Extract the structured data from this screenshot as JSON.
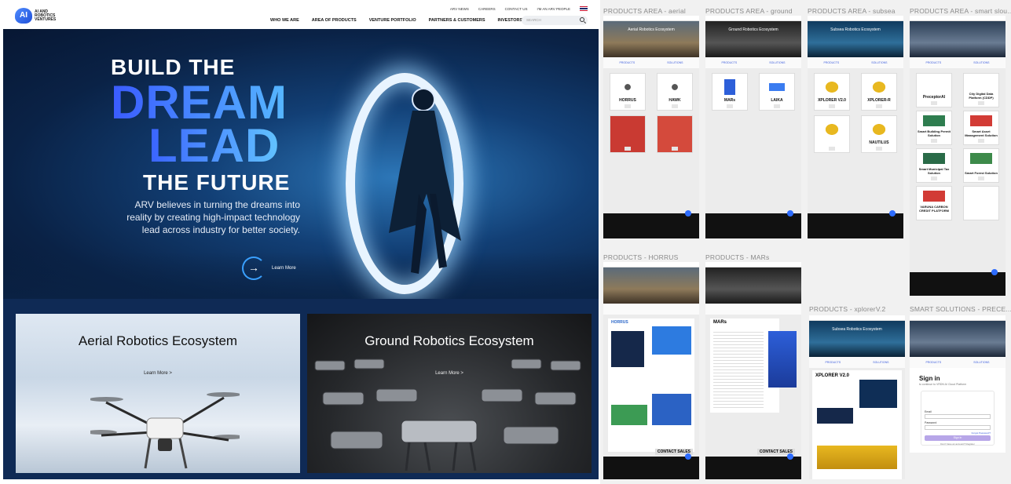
{
  "site": {
    "logo": {
      "mark": "AI",
      "text": "AI AND ROBOTICS VENTURES"
    },
    "utility_links": [
      "ARV NEWS",
      "CAREERS",
      "CONTACT US",
      "I'M AN ARV PEOPLE"
    ],
    "nav": [
      "WHO WE ARE",
      "AREA OF PRODUCTS",
      "VENTURE PORTFOLIO",
      "PARTNERS & CUSTOMERS",
      "INVESTORS"
    ],
    "search": {
      "placeholder": "SEARCH"
    },
    "hero": {
      "line1": "BUILD THE",
      "line2": "DREAM",
      "line3": "LEAD",
      "line4": "THE FUTURE",
      "body": "ARV believes in turning the dreams into reality by creating high-impact technology lead across industry for  better society.",
      "cta": "Learn More"
    },
    "ecosystems": [
      {
        "title": "Aerial Robotics Ecosystem",
        "more": "Learn More >"
      },
      {
        "title": "Ground Robotics Ecosystem",
        "more": "Learn More >"
      }
    ]
  },
  "board": {
    "labels": {
      "aerial": "PRODUCTS AREA - aerial",
      "ground": "PRODUCTS AREA - ground",
      "subsea": "PRODUCTS AREA - subsea",
      "smart": "PRODUCTS AREA - smart slou...",
      "horrus": "PRODUCTS - HORRUS",
      "mars": "PRODUCTS - MARs",
      "xplorer": "PRODUCTS - xplorerV.2",
      "precept": "SMART SOLUTIONS - PRECE..."
    },
    "aerial": {
      "banner": "Aerial Robotics Ecosystem",
      "tabs": [
        "PRODUCTS",
        "SOLUTIONS"
      ],
      "tiles": [
        "HORRUS",
        "HAWK",
        "",
        ""
      ]
    },
    "ground": {
      "banner": "Ground Robotics Ecosystem",
      "tabs": [
        "PRODUCTS",
        "SOLUTIONS"
      ],
      "tiles": [
        "MARs",
        "LAIKA"
      ]
    },
    "subsea": {
      "banner": "Subsea Robotics Ecosystem",
      "tabs": [
        "PRODUCTS",
        "SOLUTIONS"
      ],
      "tiles": [
        "XPLORER V2.0",
        "XPLORER-R",
        "",
        "NAUTILUS"
      ]
    },
    "smart": {
      "tabs": [
        "PRODUCTS",
        "SOLUTIONS"
      ],
      "tiles": [
        "PreceptorAI",
        "City Digital Data Platform (CDDP)",
        "Smart Building Permit Solution",
        "Smart Asset Management Solution",
        "Smart Municipal Tax Solution",
        "Smart Forest Solution",
        "VARUNA CARBON CREDIT PLATFORM",
        ""
      ]
    },
    "horrus": {
      "brand": "HORRUS",
      "cta": "CONTACT SALES"
    },
    "mars": {
      "title": "MARs",
      "cta": "CONTACT SALES"
    },
    "xplorer": {
      "banner": "Subsea Robotics Ecosystem",
      "tabs": [
        "PRODUCTS",
        "SOLUTIONS"
      ],
      "title": "XPLORER V2.0"
    },
    "precept": {
      "tabs": [
        "PRODUCTS",
        "SOLUTIONS"
      ],
      "signin": "Sign in",
      "subtitle": "to continue to VRDN AI Cloud Platform",
      "email": "Email",
      "password": "Password",
      "forgot": "Forgot Password?",
      "button": "Sign in",
      "register": "Don't have an account? Register"
    }
  }
}
